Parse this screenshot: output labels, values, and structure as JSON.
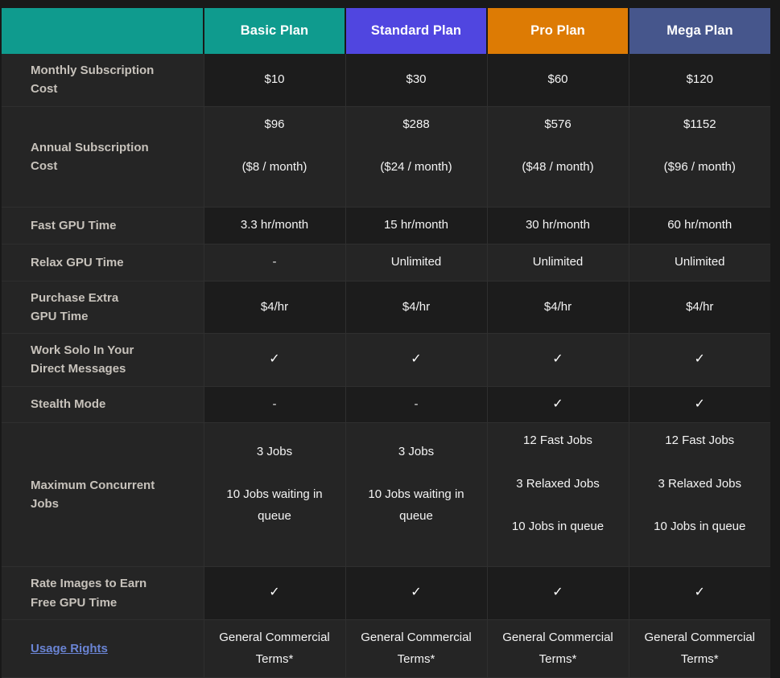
{
  "theme": {
    "page_background": "#191919",
    "row_background": "#252525",
    "row_background_alt": "#1c1c1c",
    "grid_line": "#2f2f2f",
    "label_text": "#c7c2bb",
    "value_text": "#f4f4f4",
    "link_color": "#6a84d4"
  },
  "table": {
    "header": {
      "corner_label": "",
      "corner_color": "#0f9b8e",
      "plans": [
        {
          "label": "Basic Plan",
          "color": "#0f9b8e"
        },
        {
          "label": "Standard Plan",
          "color": "#5046e0"
        },
        {
          "label": "Pro Plan",
          "color": "#dd7b04"
        },
        {
          "label": "Mega Plan",
          "color": "#46568c"
        }
      ]
    },
    "rows": [
      {
        "label": "Monthly Subscription Cost",
        "label_lines": [
          "Monthly Subscription",
          "Cost"
        ],
        "cells": [
          {
            "lines": [
              "$10"
            ]
          },
          {
            "lines": [
              "$30"
            ]
          },
          {
            "lines": [
              "$60"
            ]
          },
          {
            "lines": [
              "$120"
            ]
          }
        ]
      },
      {
        "label": "Annual Subscription Cost",
        "label_lines": [
          "Annual Subscription",
          "Cost"
        ],
        "cells": [
          {
            "lines": [
              "$96",
              "($8 / month)"
            ]
          },
          {
            "lines": [
              "$288",
              "($24 / month)"
            ]
          },
          {
            "lines": [
              "$576",
              "($48 / month)"
            ]
          },
          {
            "lines": [
              "$1152",
              "($96 / month)"
            ]
          }
        ]
      },
      {
        "label": "Fast GPU Time",
        "label_lines": [
          "Fast GPU Time"
        ],
        "cells": [
          {
            "lines": [
              "3.3 hr/month"
            ]
          },
          {
            "lines": [
              "15 hr/month"
            ]
          },
          {
            "lines": [
              "30 hr/month"
            ]
          },
          {
            "lines": [
              "60 hr/month"
            ]
          }
        ]
      },
      {
        "label": "Relax GPU Time",
        "label_lines": [
          "Relax GPU Time"
        ],
        "cells": [
          {
            "lines": [
              "-"
            ]
          },
          {
            "lines": [
              "Unlimited"
            ]
          },
          {
            "lines": [
              "Unlimited"
            ]
          },
          {
            "lines": [
              "Unlimited"
            ]
          }
        ]
      },
      {
        "label": "Purchase Extra GPU Time",
        "label_lines": [
          "Purchase Extra",
          "GPU Time"
        ],
        "cells": [
          {
            "lines": [
              "$4/hr"
            ]
          },
          {
            "lines": [
              "$4/hr"
            ]
          },
          {
            "lines": [
              "$4/hr"
            ]
          },
          {
            "lines": [
              "$4/hr"
            ]
          }
        ]
      },
      {
        "label": "Work Solo In Your Direct Messages",
        "label_lines": [
          "Work Solo In Your",
          "Direct Messages"
        ],
        "cells": [
          {
            "lines": [
              "✓"
            ]
          },
          {
            "lines": [
              "✓"
            ]
          },
          {
            "lines": [
              "✓"
            ]
          },
          {
            "lines": [
              "✓"
            ]
          }
        ]
      },
      {
        "label": "Stealth Mode",
        "label_lines": [
          "Stealth Mode"
        ],
        "cells": [
          {
            "lines": [
              "-"
            ]
          },
          {
            "lines": [
              "-"
            ]
          },
          {
            "lines": [
              "✓"
            ]
          },
          {
            "lines": [
              "✓"
            ]
          }
        ]
      },
      {
        "label": "Maximum Concurrent Jobs",
        "label_lines": [
          "Maximum Concurrent",
          "Jobs"
        ],
        "cells": [
          {
            "lines": [
              "3 Jobs",
              "10 Jobs waiting in queue"
            ]
          },
          {
            "lines": [
              "3 Jobs",
              "10 Jobs waiting in queue"
            ]
          },
          {
            "lines": [
              "12 Fast Jobs",
              "3 Relaxed Jobs",
              "10 Jobs in queue"
            ]
          },
          {
            "lines": [
              "12 Fast Jobs",
              "3 Relaxed Jobs",
              "10 Jobs in queue"
            ]
          }
        ]
      },
      {
        "label": "Rate Images to Earn Free GPU Time",
        "label_lines": [
          "Rate Images to Earn",
          "Free GPU Time"
        ],
        "cells": [
          {
            "lines": [
              "✓"
            ]
          },
          {
            "lines": [
              "✓"
            ]
          },
          {
            "lines": [
              "✓"
            ]
          },
          {
            "lines": [
              "✓"
            ]
          }
        ]
      },
      {
        "label": "Usage Rights",
        "label_lines": [
          "Usage Rights"
        ],
        "label_is_link": true,
        "cells": [
          {
            "lines": [
              "General Commercial Terms*"
            ]
          },
          {
            "lines": [
              "General Commercial Terms*"
            ]
          },
          {
            "lines": [
              "General Commercial Terms*"
            ]
          },
          {
            "lines": [
              "General Commercial Terms*"
            ]
          }
        ]
      }
    ]
  }
}
